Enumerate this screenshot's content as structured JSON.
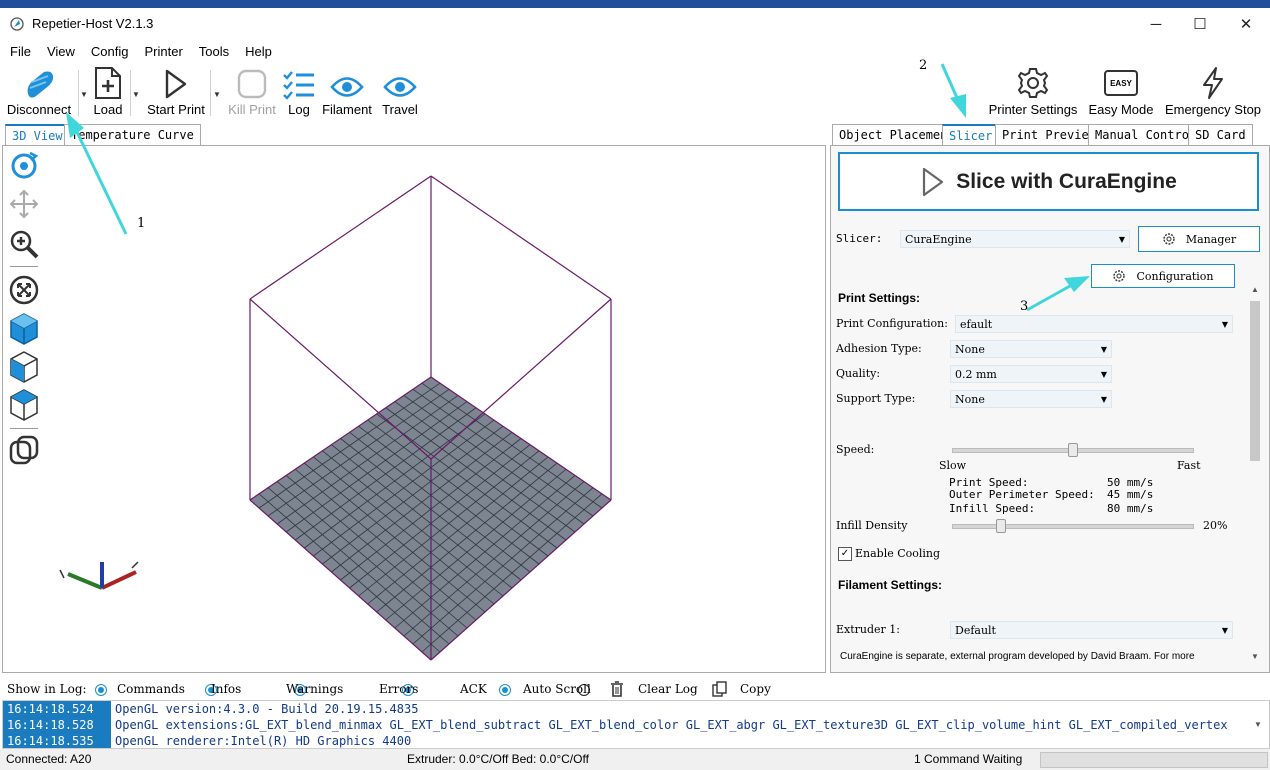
{
  "window": {
    "title": "Repetier-Host V2.1.3",
    "controls": [
      "─",
      "☐",
      "✕"
    ]
  },
  "menu": [
    "File",
    "View",
    "Config",
    "Printer",
    "Tools",
    "Help"
  ],
  "toolbar": {
    "disconnect": "Disconnect",
    "load": "Load",
    "start_print": "Start Print",
    "kill_print": "Kill Print",
    "log": "Log",
    "filament": "Filament",
    "travel": "Travel",
    "printer_settings": "Printer Settings",
    "easy_mode": "Easy Mode",
    "easy_badge": "EASY",
    "emergency_stop": "Emergency Stop"
  },
  "left_tabs": [
    "3D View",
    "Temperature Curve"
  ],
  "right_tabs": [
    "Object Placement",
    "Slicer",
    "Print Preview",
    "Manual Control",
    "SD Card"
  ],
  "slicer": {
    "slice_button": "Slice with CuraEngine",
    "slicer_label": "Slicer:",
    "slicer_value": "CuraEngine",
    "manager": "Manager",
    "configuration": "Configuration",
    "print_settings": "Print Settings:",
    "print_configuration_label": "Print Configuration:",
    "print_configuration_value": "efault",
    "adhesion_label": "Adhesion Type:",
    "adhesion_value": "None",
    "quality_label": "Quality:",
    "quality_value": "0.2 mm",
    "support_label": "Support Type:",
    "support_value": "None",
    "speed_label": "Speed:",
    "slow": "Slow",
    "fast": "Fast",
    "speed_level": 0.5,
    "print_speed_label": "Print Speed:",
    "print_speed_value": "50 mm/s",
    "outer_speed_label": "Outer Perimeter Speed:",
    "outer_speed_value": "45 mm/s",
    "infill_speed_label": "Infill Speed:",
    "infill_speed_value": "80 mm/s",
    "infill_label": "Infill Density",
    "infill_value": "20%",
    "infill_level": 0.2,
    "cooling_label": "Enable Cooling",
    "cooling_checked": true,
    "filament_settings": "Filament Settings:",
    "extruder_label": "Extruder 1:",
    "extruder_value": "Default",
    "note": "CuraEngine is separate, external program developed by David Braam. For more"
  },
  "log": {
    "show_label": "Show in Log:",
    "filters": [
      "Commands",
      "Infos",
      "Warnings",
      "Errors",
      "ACK"
    ],
    "auto_scroll": "Auto Scroll",
    "clear_log": "Clear Log",
    "copy": "Copy",
    "entries": [
      {
        "time": "16:14:18.524",
        "text": "OpenGL version:4.3.0 - Build 20.19.15.4835"
      },
      {
        "time": "16:14:18.528",
        "text": "OpenGL extensions:GL_EXT_blend_minmax GL_EXT_blend_subtract GL_EXT_blend_color GL_EXT_abgr GL_EXT_texture3D GL_EXT_clip_volume_hint GL_EXT_compiled_vertex"
      },
      {
        "time": "16:14:18.535",
        "text": "OpenGL renderer:Intel(R) HD Graphics 4400"
      }
    ]
  },
  "status": {
    "connected": "Connected: A20",
    "temps": "Extruder: 0.0°C/Off Bed: 0.0°C/Off",
    "waiting": "1 Command Waiting"
  },
  "annotations": [
    "1",
    "2",
    "3"
  ],
  "colors": {
    "accent": "#1a8fd0",
    "arrow": "#3fd6dc",
    "box": "#6a1a6a",
    "bed": "#7d8590"
  }
}
